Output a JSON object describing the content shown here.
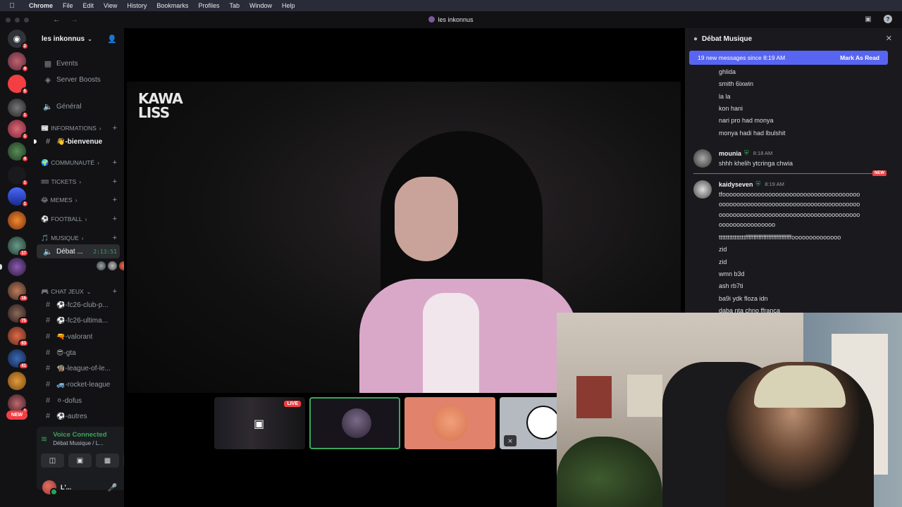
{
  "menubar": {
    "items": [
      "Chrome",
      "File",
      "Edit",
      "View",
      "History",
      "Bookmarks",
      "Profiles",
      "Tab",
      "Window",
      "Help"
    ]
  },
  "window": {
    "title": "les inkonnus"
  },
  "rail": {
    "badges": [
      "2",
      "4",
      "5",
      "1",
      "1",
      "4",
      "1",
      "1",
      "17",
      "16",
      "75",
      "63",
      "41",
      "1"
    ],
    "new_label": "NEW"
  },
  "sidebar": {
    "server_name": "les inkonnus",
    "top": [
      {
        "icon": "calendar-icon",
        "label": "Events"
      },
      {
        "icon": "boost-icon",
        "label": "Server Boosts"
      },
      {
        "icon": "speaker-icon",
        "label": "Général"
      }
    ],
    "categories": [
      {
        "emoji": "📰",
        "label": "INFORMATIONS"
      },
      {
        "emoji": "🌍",
        "label": "COMMUNAUTÉ"
      },
      {
        "emoji": "🎟",
        "label": "TICKETS"
      },
      {
        "emoji": "😂",
        "label": "MEMES"
      },
      {
        "emoji": "⚽",
        "label": "FOOTBALL"
      },
      {
        "emoji": "🎵",
        "label": "MUSIQUE"
      },
      {
        "emoji": "🎮",
        "label": "CHAT JEUX"
      }
    ],
    "bienvenue": "👋-bienvenue",
    "voice_channel": {
      "label": "Débat ...",
      "timer": "2:13:51"
    },
    "game_channels": [
      "⚽-fc26-club-p...",
      "⚽-fc26-ultima...",
      "🔫-valorant",
      "😎-gta",
      "🧌-league-of-le...",
      "🚙-rocket-league",
      "⚪-dofus",
      "⚽-autres"
    ]
  },
  "voice_panel": {
    "title": "Voice Connected",
    "subtitle": "Débat Musique / L..."
  },
  "user_panel": {
    "name": "L'..."
  },
  "stream": {
    "overlay_logo_line1": "KAWA",
    "overlay_logo_line2": "LISS",
    "live_label": "LIVE"
  },
  "chat": {
    "title": "Débat Musique",
    "new_messages": "19 new messages since 8:19 AM",
    "mark_as_read": "Mark As Read",
    "early_lines": [
      "ghlida",
      "smith 6ixwin",
      "la la",
      "kon hani",
      "nari pro had monya",
      "monya hadi had lbulshit"
    ],
    "msg1": {
      "author": "mounia",
      "time": "8:18 AM",
      "text": "shhh khelih ytcringa chwia"
    },
    "new_tag": "NEW",
    "msg2": {
      "author": "kaidyseven",
      "time": "8:19 AM",
      "lines": [
        "tfooooooooooooooooooooooooooooooooooooooo",
        "oooooooooooooooooooooooooooooooooooooooo",
        "oooooooooooooooooooooooooooooooooooooooo",
        "oooooooooooooooo",
        "tttttttttttttttffffffffffffffffffffffffffffoooooooooooooo",
        "zid",
        "zid",
        "wmn b3d",
        "ash rb7ti",
        "ba9i ydk floza idn",
        "daba nta chno ffranca"
      ]
    }
  },
  "colors": {
    "accent": "#5865f2",
    "voice_green": "#3ba55c",
    "danger": "#f23f43"
  }
}
